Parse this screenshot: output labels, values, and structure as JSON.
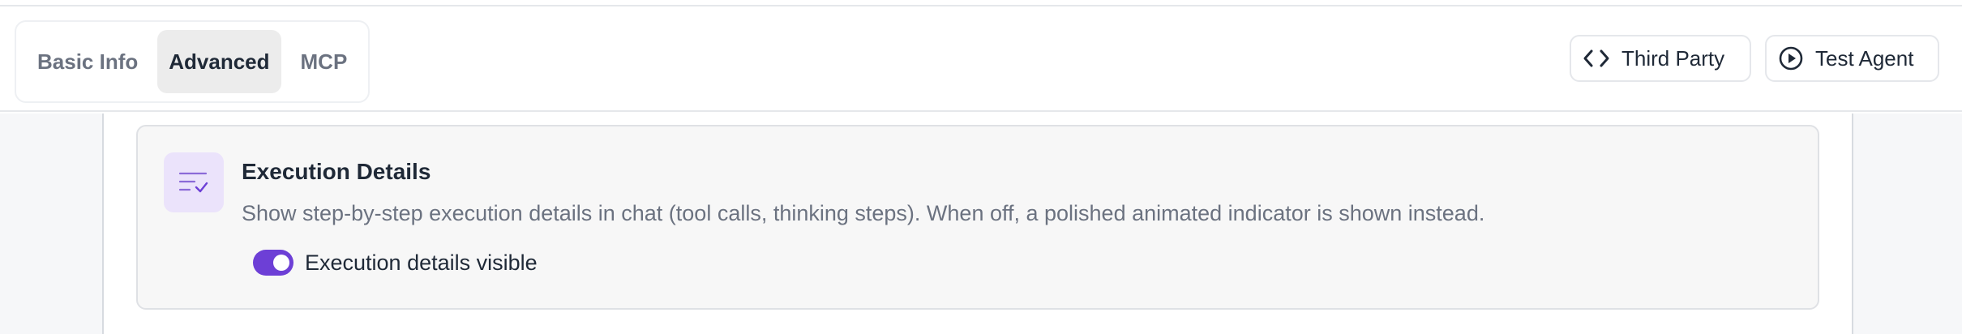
{
  "tabs": [
    {
      "label": "Basic Info",
      "active": false
    },
    {
      "label": "Advanced",
      "active": true
    },
    {
      "label": "MCP",
      "active": false
    }
  ],
  "actions": {
    "third_party": {
      "label": "Third Party",
      "icon": "code-icon"
    },
    "test_agent": {
      "label": "Test Agent",
      "icon": "play-circle-icon"
    }
  },
  "card": {
    "icon": "list-check-icon",
    "title": "Execution Details",
    "description": "Show step-by-step execution details in chat (tool calls, thinking steps). When off, a polished animated indicator is shown instead.",
    "toggle": {
      "label": "Execution details visible",
      "on": true
    }
  },
  "colors": {
    "accent": "#6d3fd6",
    "icon_bg": "#ebe3fb"
  }
}
